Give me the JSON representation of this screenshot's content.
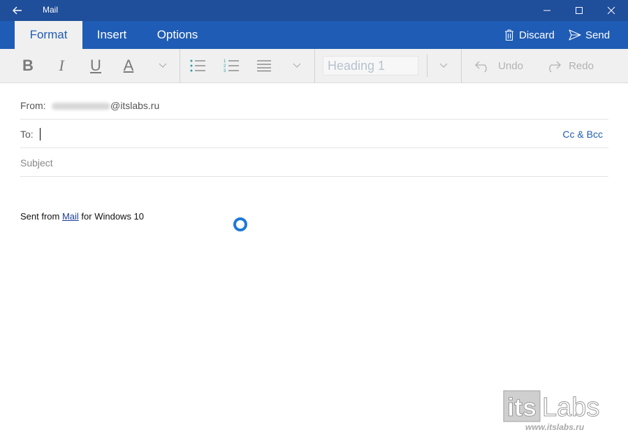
{
  "window": {
    "title": "Mail"
  },
  "ribbon": {
    "tabs": [
      {
        "label": "Format",
        "active": true
      },
      {
        "label": "Insert",
        "active": false
      },
      {
        "label": "Options",
        "active": false
      }
    ],
    "discard_label": "Discard",
    "send_label": "Send"
  },
  "toolbar": {
    "bold": "B",
    "italic": "I",
    "underline": "U",
    "font_color": "A",
    "style_value": "Heading 1",
    "undo_label": "Undo",
    "redo_label": "Redo"
  },
  "compose": {
    "from_label": "From:",
    "from_domain": "@itslabs.ru",
    "to_label": "To:",
    "cc_bcc_label": "Cc & Bcc",
    "subject_placeholder": "Subject",
    "signature_before": "Sent from ",
    "signature_link": "Mail",
    "signature_after": " for Windows 10"
  },
  "watermark": {
    "logo_text": "itsLabs",
    "url": "www.itslabs.ru"
  },
  "colors": {
    "titlebar": "#1f4e9a",
    "ribbon": "#1f5cb5",
    "toolbar": "#f0f0f0",
    "link": "#1f5cb5",
    "spinner": "#1e78d7"
  },
  "icons": [
    "back-arrow-icon",
    "minimize-icon",
    "maximize-icon",
    "close-icon",
    "trash-icon",
    "send-icon",
    "bullet-list-icon",
    "numbered-list-icon",
    "align-icon",
    "chevron-down-icon",
    "undo-icon",
    "redo-icon",
    "loading-spinner-icon"
  ]
}
